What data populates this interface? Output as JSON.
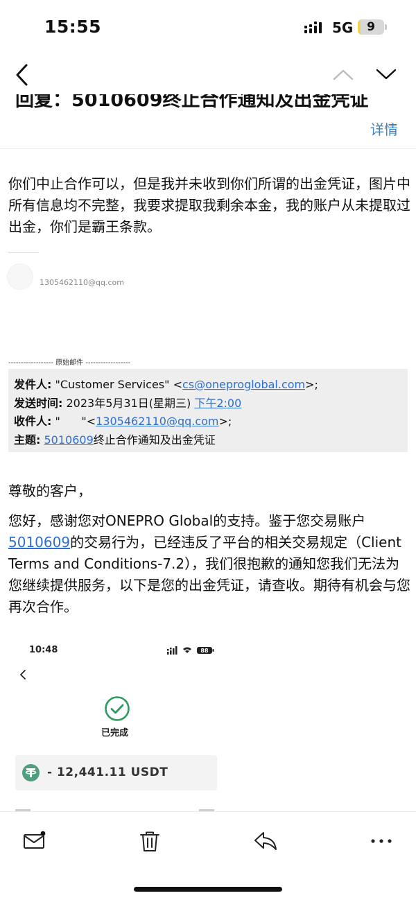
{
  "status_bar": {
    "time": "15:55",
    "network": "5G",
    "battery_level": "9",
    "battery_fraction": 0.09,
    "battery_color": "#f2d44a",
    "signal_icon": "signal-bars-icon"
  },
  "nav": {
    "back_icon": "chevron-left-icon",
    "prev_icon": "chevron-up-icon",
    "next_icon": "chevron-down-icon"
  },
  "email": {
    "subject": "回复：5010609终止合作通知及出金凭证",
    "details_label": "详情",
    "reply_text": "你们中止合作可以，但是我并未收到你们所谓的出金凭证，图片中所有信息均不完整，我要求提取我剩余本金，我的账户从未提取过出金，你们是霸王条款。",
    "sender_email": "1305462110@qq.com",
    "original_separator": "------------------ 原始邮件 ------------------",
    "original_header": {
      "from_label": "发件人:",
      "from_name": " \"Customer Services\" <",
      "from_address": "cs@oneproglobal.com",
      "from_suffix": ">;",
      "date_label": "发送时间:",
      "date_value": " 2023年5月31日(星期三) ",
      "date_time": "下午2:00",
      "to_label": "收件人:",
      "to_prefix": " \"      \"<",
      "to_address": "1305462110@qq.com",
      "to_suffix": ">;",
      "subject_label": "主题:",
      "subject_link": "5010609",
      "subject_rest": "终止合作通知及出金凭证"
    },
    "body": {
      "greeting": "尊敬的客户，",
      "part1": "您好，感谢您对ONEPRO Global的支持。鉴于您交易账户",
      "account_link": "5010609",
      "part2": "的交易行为，已经违反了平台的相关交易规定（Client Terms and Conditions-7.2），我们很抱歉的通知您我们无法为您继续提供服务，以下是您的出金凭证，请查收。期待有机会与您再次合作。"
    },
    "link_color": "#2f6fd0"
  },
  "embedded_screenshot": {
    "time": "10:48",
    "battery": "88",
    "status_label": "已完成",
    "amount": "- 12,441.11 USDT",
    "coin_icon": "tether-icon",
    "check_icon": "check-circle-icon"
  },
  "toolbar": {
    "items": [
      "mail-unread-icon",
      "trash-icon",
      "reply-icon",
      "more-icon"
    ]
  }
}
